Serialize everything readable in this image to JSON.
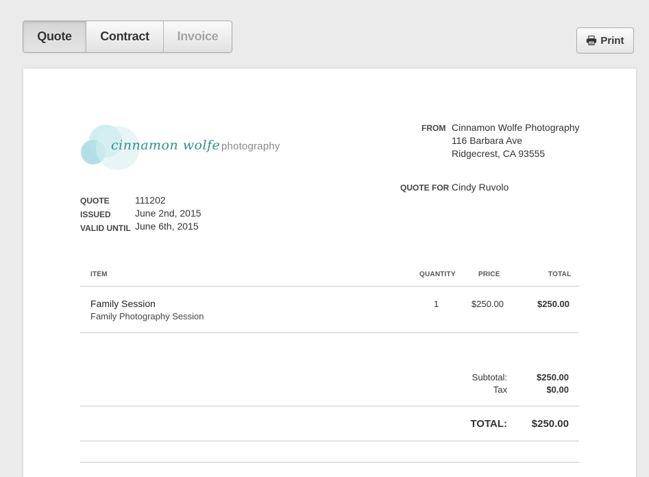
{
  "tabs": [
    {
      "label": "Quote",
      "state": "active"
    },
    {
      "label": "Contract",
      "state": "normal"
    },
    {
      "label": "Invoice",
      "state": "disabled"
    }
  ],
  "print_button": {
    "label": "Print",
    "icon": "printer-icon"
  },
  "logo": {
    "script": "cinnamon wolfe",
    "sub": "photography",
    "accent_colors": [
      "#8fd3dc",
      "#b9e3e8",
      "#d7eff1"
    ]
  },
  "from": {
    "label": "FROM",
    "lines": [
      "Cinnamon Wolfe Photography",
      "116 Barbara Ave",
      "Ridgecrest, CA 93555"
    ]
  },
  "quote_for": {
    "label": "QUOTE FOR",
    "name": "Cindy Ruvolo"
  },
  "meta": {
    "quote_label": "QUOTE",
    "quote_value": "111202",
    "issued_label": "ISSUED",
    "issued_value": "June 2nd, 2015",
    "valid_label": "VALID UNTIL",
    "valid_value": "June 6th, 2015"
  },
  "table": {
    "headers": {
      "item": "ITEM",
      "quantity": "QUANTITY",
      "price": "PRICE",
      "total": "TOTAL"
    },
    "rows": [
      {
        "title": "Family Session",
        "description": "Family Photography Session",
        "quantity": "1",
        "price": "$250.00",
        "total": "$250.00"
      }
    ]
  },
  "totals": {
    "subtotal_label": "Subtotal:",
    "subtotal_value": "$250.00",
    "tax_label": "Tax",
    "tax_value": "$0.00",
    "total_label": "TOTAL:",
    "total_value": "$250.00"
  }
}
